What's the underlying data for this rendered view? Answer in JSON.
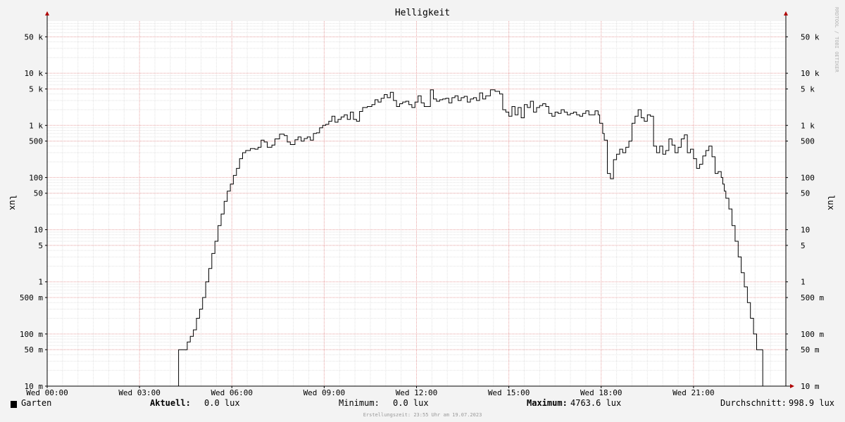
{
  "chart_data": {
    "type": "line",
    "title": "Helligkeit",
    "ylabel": "lux",
    "yscale": "log",
    "ylim": [
      0.01,
      100000
    ],
    "grid": true,
    "x_ticks": [
      "Wed 00:00",
      "Wed 03:00",
      "Wed 06:00",
      "Wed 09:00",
      "Wed 12:00",
      "Wed 15:00",
      "Wed 18:00",
      "Wed 21:00"
    ],
    "y_ticks": [
      {
        "value": 50000,
        "label": "50 k"
      },
      {
        "value": 10000,
        "label": "10 k"
      },
      {
        "value": 5000,
        "label": "5 k"
      },
      {
        "value": 1000,
        "label": "1 k"
      },
      {
        "value": 500,
        "label": "500"
      },
      {
        "value": 100,
        "label": "100"
      },
      {
        "value": 50,
        "label": "50"
      },
      {
        "value": 10,
        "label": "10"
      },
      {
        "value": 5,
        "label": "5"
      },
      {
        "value": 1,
        "label": "1"
      },
      {
        "value": 0.5,
        "label": "500 m"
      },
      {
        "value": 0.1,
        "label": "100 m"
      },
      {
        "value": 0.05,
        "label": "50 m"
      },
      {
        "value": 0.01,
        "label": "10 m"
      }
    ],
    "series": [
      {
        "name": "Garten",
        "color": "#000000",
        "x_unit": "hours",
        "points": [
          [
            0.0,
            0.01
          ],
          [
            4.25,
            0.01
          ],
          [
            4.27,
            0.05
          ],
          [
            4.5,
            0.05
          ],
          [
            4.55,
            0.07
          ],
          [
            4.65,
            0.09
          ],
          [
            4.75,
            0.12
          ],
          [
            4.85,
            0.2
          ],
          [
            4.95,
            0.3
          ],
          [
            5.05,
            0.5
          ],
          [
            5.15,
            1
          ],
          [
            5.25,
            1.8
          ],
          [
            5.35,
            3.5
          ],
          [
            5.45,
            6
          ],
          [
            5.55,
            12
          ],
          [
            5.65,
            20
          ],
          [
            5.75,
            35
          ],
          [
            5.85,
            55
          ],
          [
            5.95,
            75
          ],
          [
            6.05,
            110
          ],
          [
            6.15,
            150
          ],
          [
            6.25,
            230
          ],
          [
            6.35,
            300
          ],
          [
            6.45,
            330
          ],
          [
            6.6,
            360
          ],
          [
            6.75,
            350
          ],
          [
            6.85,
            380
          ],
          [
            6.95,
            520
          ],
          [
            7.05,
            480
          ],
          [
            7.15,
            380
          ],
          [
            7.3,
            420
          ],
          [
            7.4,
            550
          ],
          [
            7.55,
            680
          ],
          [
            7.7,
            640
          ],
          [
            7.8,
            480
          ],
          [
            7.9,
            430
          ],
          [
            8.05,
            530
          ],
          [
            8.15,
            600
          ],
          [
            8.25,
            500
          ],
          [
            8.35,
            560
          ],
          [
            8.45,
            600
          ],
          [
            8.55,
            520
          ],
          [
            8.65,
            700
          ],
          [
            8.75,
            720
          ],
          [
            8.85,
            900
          ],
          [
            8.95,
            1000
          ],
          [
            9.05,
            1050
          ],
          [
            9.15,
            1200
          ],
          [
            9.25,
            1500
          ],
          [
            9.35,
            1150
          ],
          [
            9.45,
            1300
          ],
          [
            9.55,
            1450
          ],
          [
            9.65,
            1600
          ],
          [
            9.75,
            1300
          ],
          [
            9.85,
            1800
          ],
          [
            9.95,
            1300
          ],
          [
            10.05,
            1200
          ],
          [
            10.15,
            1850
          ],
          [
            10.25,
            2200
          ],
          [
            10.4,
            2300
          ],
          [
            10.55,
            2500
          ],
          [
            10.65,
            3100
          ],
          [
            10.75,
            2800
          ],
          [
            10.85,
            3300
          ],
          [
            10.95,
            3900
          ],
          [
            11.05,
            3400
          ],
          [
            11.15,
            4300
          ],
          [
            11.25,
            3000
          ],
          [
            11.35,
            2300
          ],
          [
            11.45,
            2600
          ],
          [
            11.55,
            2800
          ],
          [
            11.65,
            2900
          ],
          [
            11.75,
            2500
          ],
          [
            11.85,
            2200
          ],
          [
            11.95,
            2800
          ],
          [
            12.05,
            3700
          ],
          [
            12.15,
            2700
          ],
          [
            12.25,
            2300
          ],
          [
            12.35,
            2300
          ],
          [
            12.45,
            4800
          ],
          [
            12.55,
            3200
          ],
          [
            12.65,
            2900
          ],
          [
            12.75,
            3100
          ],
          [
            12.85,
            3200
          ],
          [
            12.95,
            3300
          ],
          [
            13.05,
            2700
          ],
          [
            13.15,
            3400
          ],
          [
            13.25,
            3700
          ],
          [
            13.35,
            3000
          ],
          [
            13.45,
            3400
          ],
          [
            13.55,
            3600
          ],
          [
            13.65,
            2800
          ],
          [
            13.75,
            3200
          ],
          [
            13.85,
            3400
          ],
          [
            13.95,
            3000
          ],
          [
            14.05,
            4200
          ],
          [
            14.15,
            3200
          ],
          [
            14.25,
            3700
          ],
          [
            14.4,
            4800
          ],
          [
            14.55,
            4500
          ],
          [
            14.7,
            4000
          ],
          [
            14.8,
            2000
          ],
          [
            14.9,
            1800
          ],
          [
            15.0,
            1500
          ],
          [
            15.1,
            2300
          ],
          [
            15.2,
            1600
          ],
          [
            15.3,
            2200
          ],
          [
            15.4,
            1400
          ],
          [
            15.5,
            2500
          ],
          [
            15.6,
            2200
          ],
          [
            15.7,
            2900
          ],
          [
            15.8,
            1800
          ],
          [
            15.9,
            2200
          ],
          [
            16.0,
            2400
          ],
          [
            16.1,
            2600
          ],
          [
            16.2,
            2300
          ],
          [
            16.3,
            1700
          ],
          [
            16.4,
            1500
          ],
          [
            16.5,
            1800
          ],
          [
            16.6,
            1700
          ],
          [
            16.7,
            2000
          ],
          [
            16.8,
            1800
          ],
          [
            16.9,
            1600
          ],
          [
            17.0,
            1700
          ],
          [
            17.1,
            1800
          ],
          [
            17.2,
            1600
          ],
          [
            17.3,
            1500
          ],
          [
            17.4,
            1700
          ],
          [
            17.5,
            1900
          ],
          [
            17.6,
            1600
          ],
          [
            17.7,
            1600
          ],
          [
            17.8,
            1900
          ],
          [
            17.9,
            1600
          ],
          [
            17.95,
            1100
          ],
          [
            18.05,
            700
          ],
          [
            18.1,
            520
          ],
          [
            18.2,
            120
          ],
          [
            18.3,
            95
          ],
          [
            18.4,
            220
          ],
          [
            18.5,
            280
          ],
          [
            18.6,
            350
          ],
          [
            18.7,
            300
          ],
          [
            18.8,
            380
          ],
          [
            18.9,
            500
          ],
          [
            19.0,
            1100
          ],
          [
            19.1,
            1500
          ],
          [
            19.2,
            2000
          ],
          [
            19.3,
            1400
          ],
          [
            19.4,
            1200
          ],
          [
            19.5,
            1600
          ],
          [
            19.6,
            1500
          ],
          [
            19.7,
            400
          ],
          [
            19.8,
            300
          ],
          [
            19.9,
            400
          ],
          [
            20.0,
            280
          ],
          [
            20.1,
            330
          ],
          [
            20.2,
            550
          ],
          [
            20.3,
            420
          ],
          [
            20.4,
            300
          ],
          [
            20.5,
            380
          ],
          [
            20.6,
            550
          ],
          [
            20.7,
            660
          ],
          [
            20.8,
            300
          ],
          [
            20.9,
            350
          ],
          [
            21.0,
            230
          ],
          [
            21.1,
            150
          ],
          [
            21.2,
            180
          ],
          [
            21.3,
            260
          ],
          [
            21.4,
            330
          ],
          [
            21.5,
            400
          ],
          [
            21.6,
            250
          ],
          [
            21.7,
            120
          ],
          [
            21.8,
            130
          ],
          [
            21.9,
            100
          ],
          [
            21.95,
            75
          ],
          [
            22.0,
            55
          ],
          [
            22.05,
            40
          ],
          [
            22.15,
            25
          ],
          [
            22.25,
            12
          ],
          [
            22.35,
            6
          ],
          [
            22.45,
            3
          ],
          [
            22.55,
            1.5
          ],
          [
            22.65,
            0.8
          ],
          [
            22.75,
            0.4
          ],
          [
            22.85,
            0.2
          ],
          [
            22.95,
            0.1
          ],
          [
            23.05,
            0.05
          ],
          [
            23.15,
            0.05
          ],
          [
            23.25,
            0.01
          ],
          [
            24.0,
            0.01
          ]
        ]
      }
    ]
  },
  "legend": {
    "series_name": "Garten",
    "current_label": "Aktuell:",
    "current_value": "0.0 lux",
    "min_label": "Minimum:",
    "min_value": "0.0 lux",
    "max_label": "Maximum:",
    "max_value": "4763.6 lux",
    "avg_label": "Durchschnitt:",
    "avg_value": "998.9 lux"
  },
  "footer": "Erstellungszeit: 23:55 Uhr am 19.07.2023",
  "watermark": "RRDTOOL / TOBI OETIKER"
}
